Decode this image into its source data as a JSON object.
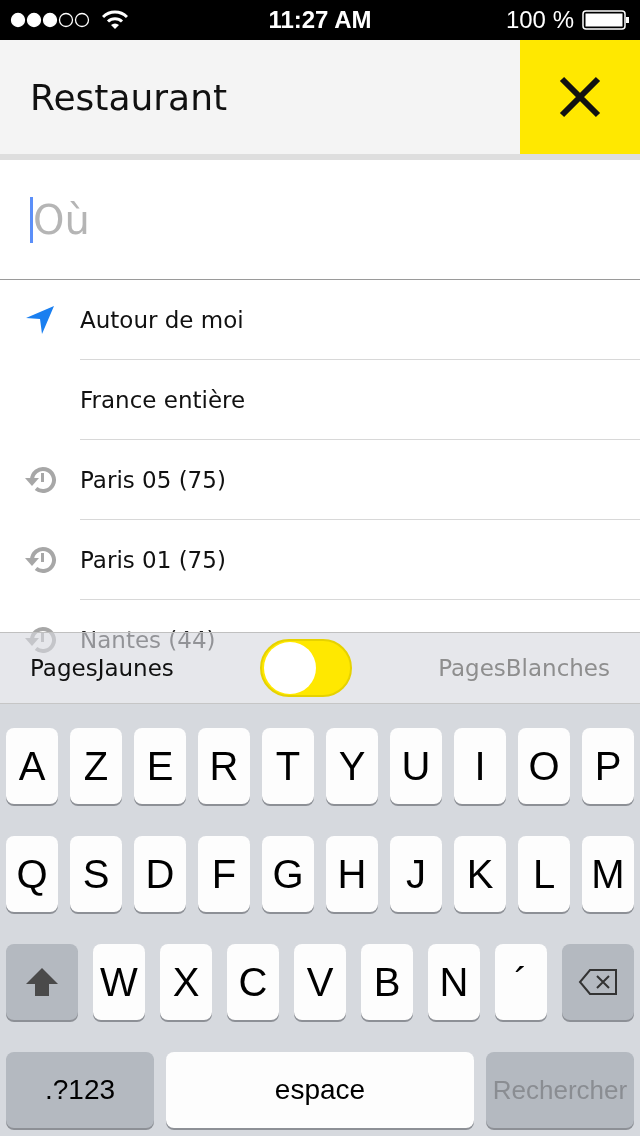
{
  "status_bar": {
    "time": "11:27 AM",
    "battery": "100 %"
  },
  "header": {
    "title": "Restaurant"
  },
  "search": {
    "placeholder": "Où"
  },
  "suggestions": [
    {
      "kind": "location",
      "label": "Autour de moi"
    },
    {
      "kind": "plain",
      "label": "France entière"
    },
    {
      "kind": "history",
      "label": "Paris 05 (75)"
    },
    {
      "kind": "history",
      "label": "Paris 01 (75)"
    },
    {
      "kind": "history",
      "label": "Nantes (44)"
    }
  ],
  "directory_switch": {
    "on": false,
    "options": [
      {
        "label": "PagesJaunes",
        "selected": true
      },
      {
        "label": "PagesBlanches",
        "selected": false
      }
    ]
  },
  "keyboard": {
    "rows": [
      {
        "keys": [
          {
            "kind": "letter",
            "label": "A"
          },
          {
            "kind": "letter",
            "label": "Z"
          },
          {
            "kind": "letter",
            "label": "E"
          },
          {
            "kind": "letter",
            "label": "R"
          },
          {
            "kind": "letter",
            "label": "T"
          },
          {
            "kind": "letter",
            "label": "Y"
          },
          {
            "kind": "letter",
            "label": "U"
          },
          {
            "kind": "letter",
            "label": "I"
          },
          {
            "kind": "letter",
            "label": "O"
          },
          {
            "kind": "letter",
            "label": "P"
          }
        ]
      },
      {
        "keys": [
          {
            "kind": "letter",
            "label": "Q"
          },
          {
            "kind": "letter",
            "label": "S"
          },
          {
            "kind": "letter",
            "label": "D"
          },
          {
            "kind": "letter",
            "label": "F"
          },
          {
            "kind": "letter",
            "label": "G"
          },
          {
            "kind": "letter",
            "label": "H"
          },
          {
            "kind": "letter",
            "label": "J"
          },
          {
            "kind": "letter",
            "label": "K"
          },
          {
            "kind": "letter",
            "label": "L"
          },
          {
            "kind": "letter",
            "label": "M"
          }
        ]
      },
      {
        "keys": [
          {
            "kind": "shift"
          },
          {
            "kind": "letter",
            "label": "W"
          },
          {
            "kind": "letter",
            "label": "X"
          },
          {
            "kind": "letter",
            "label": "C"
          },
          {
            "kind": "letter",
            "label": "V"
          },
          {
            "kind": "letter",
            "label": "B"
          },
          {
            "kind": "letter",
            "label": "N"
          },
          {
            "kind": "letter",
            "label": "´"
          },
          {
            "kind": "delete"
          }
        ]
      },
      {
        "keys": [
          {
            "kind": "mode",
            "label": ".?123"
          },
          {
            "kind": "space",
            "label": "espace"
          },
          {
            "kind": "action",
            "label": "Rechercher",
            "disabled": true
          }
        ]
      }
    ]
  }
}
